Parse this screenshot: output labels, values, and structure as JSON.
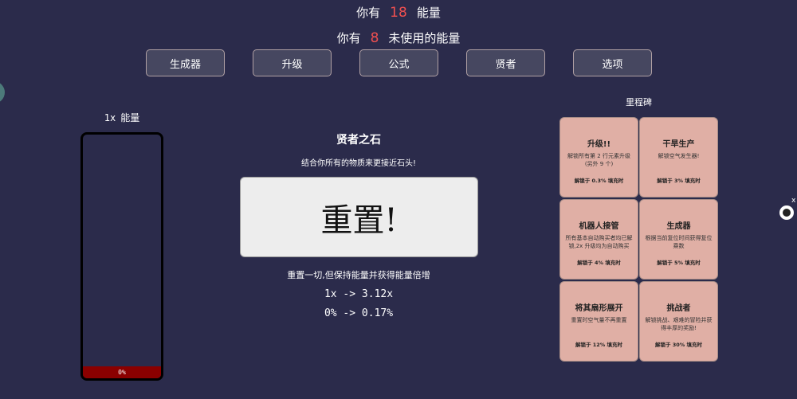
{
  "header": {
    "energy_prefix": "你有",
    "energy_value": "18",
    "energy_suffix": "能量",
    "unused_prefix": "你有",
    "unused_value": "8",
    "unused_suffix": "未使用的能量"
  },
  "tabs": [
    {
      "label": "生成器"
    },
    {
      "label": "升级"
    },
    {
      "label": "公式"
    },
    {
      "label": "贤者"
    },
    {
      "label": "选项"
    }
  ],
  "energy_bar": {
    "multiplier": "1x",
    "label": "能量",
    "fill_text": "0%",
    "fill_fraction": 0.0,
    "fill_color": "#8b0000"
  },
  "sage": {
    "title": "贤者之石",
    "subtitle": "结合你所有的物质来更接近石头!",
    "button_label": "重置!",
    "description": "重置一切,但保持能量并获得能量倍增",
    "multiplier_change": "1x -> 3.12x",
    "percent_change": "0% -> 0.17%"
  },
  "milestones": {
    "title": "里程碑",
    "items": [
      {
        "title": "升级!!",
        "desc": "解锁所有第 2 行元素升级 (另外 9 个)",
        "req": "解锁于 0.3% 填充时"
      },
      {
        "title": "干旱生产",
        "desc": "解锁空气发生器!",
        "req": "解锁于 3% 填充时"
      },
      {
        "title": "机器人接管",
        "desc": "所有基本自动购买者均已解锁,2x 升级均为自动购买",
        "req": "解锁于 4% 填充时"
      },
      {
        "title": "生成器",
        "desc": "根据当前复位时间获得复位乘数",
        "req": "解锁于 5% 填充时"
      },
      {
        "title": "将其扇形展开",
        "desc": "重置时空气量不再重置",
        "req": "解锁于 12% 填充时"
      },
      {
        "title": "挑战者",
        "desc": "解锁挑战、艰难的冒险并获得丰厚的奖励!",
        "req": "解锁于 30% 填充时"
      }
    ]
  },
  "misc": {
    "close_label": "x",
    "icon_name": "github-icon"
  }
}
